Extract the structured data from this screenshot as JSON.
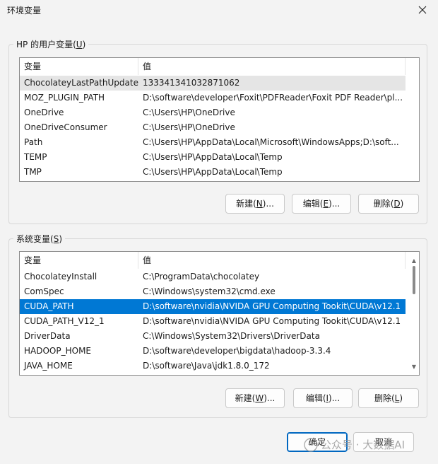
{
  "window": {
    "title": "环境变量"
  },
  "user_group": {
    "legend": "HP 的用户变量(",
    "legend_key": "U",
    "legend_end": ")",
    "headers": {
      "name": "变量",
      "value": "值"
    },
    "rows": [
      {
        "name": "ChocolateyLastPathUpdate",
        "value": "133341341032871062"
      },
      {
        "name": "MOZ_PLUGIN_PATH",
        "value": "D:\\software\\developer\\Foxit\\PDFReader\\Foxit PDF Reader\\pl..."
      },
      {
        "name": "OneDrive",
        "value": "C:\\Users\\HP\\OneDrive"
      },
      {
        "name": "OneDriveConsumer",
        "value": "C:\\Users\\HP\\OneDrive"
      },
      {
        "name": "Path",
        "value": "C:\\Users\\HP\\AppData\\Local\\Microsoft\\WindowsApps;D:\\soft..."
      },
      {
        "name": "TEMP",
        "value": "C:\\Users\\HP\\AppData\\Local\\Temp"
      },
      {
        "name": "TMP",
        "value": "C:\\Users\\HP\\AppData\\Local\\Temp"
      }
    ],
    "buttons": {
      "new": {
        "label": "新建(",
        "key": "N",
        "end": ")..."
      },
      "edit": {
        "label": "编辑(",
        "key": "E",
        "end": ")..."
      },
      "delete": {
        "label": "删除(",
        "key": "D",
        "end": ")"
      }
    }
  },
  "system_group": {
    "legend": "系统变量(",
    "legend_key": "S",
    "legend_end": ")",
    "headers": {
      "name": "变量",
      "value": "值"
    },
    "rows": [
      {
        "name": "ChocolateyInstall",
        "value": "C:\\ProgramData\\chocolatey"
      },
      {
        "name": "ComSpec",
        "value": "C:\\Windows\\system32\\cmd.exe"
      },
      {
        "name": "CUDA_PATH",
        "value": "D:\\software\\nvidia\\NVIDA GPU Computing Tookit\\CUDA\\v12.1"
      },
      {
        "name": "CUDA_PATH_V12_1",
        "value": "D:\\software\\nvidia\\NVIDA GPU Computing Tookit\\CUDA\\v12.1"
      },
      {
        "name": "DriverData",
        "value": "C:\\Windows\\System32\\Drivers\\DriverData"
      },
      {
        "name": "HADOOP_HOME",
        "value": "D:\\software\\developer\\bigdata\\hadoop-3.3.4"
      },
      {
        "name": "JAVA_HOME",
        "value": "D:\\software\\Java\\jdk1.8.0_172"
      }
    ],
    "buttons": {
      "new": {
        "label": "新建(",
        "key": "W",
        "end": ")..."
      },
      "edit": {
        "label": "编辑(",
        "key": "I",
        "end": ")..."
      },
      "delete": {
        "label": "删除(",
        "key": "L",
        "end": ")"
      }
    }
  },
  "footer": {
    "ok": "确定",
    "cancel": "取消"
  },
  "watermark": {
    "text": "公众号 · 大数据AI"
  },
  "colors": {
    "selection": "#0078d4",
    "hover": "#e5e5e5",
    "primary_border": "#0067c0"
  }
}
